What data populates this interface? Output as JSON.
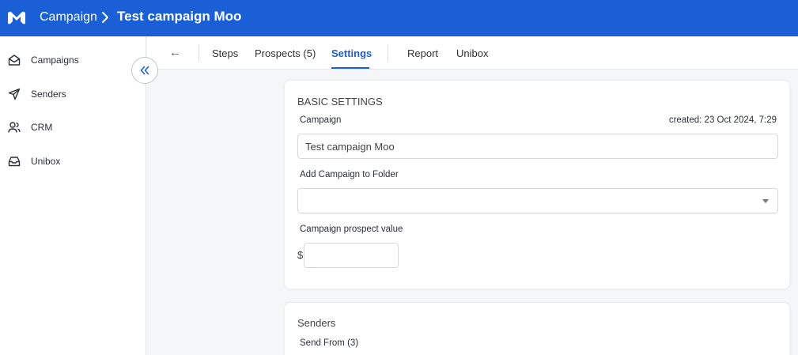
{
  "header": {
    "breadcrumb_root": "Campaign",
    "campaign_title": "Test campaign Moo",
    "brand_color": "#1a5fd6"
  },
  "sidebar": {
    "items": [
      {
        "label": "Campaigns",
        "icon": "envelope-open-icon"
      },
      {
        "label": "Senders",
        "icon": "paper-plane-icon"
      },
      {
        "label": "CRM",
        "icon": "users-icon"
      },
      {
        "label": "Unibox",
        "icon": "inbox-icon"
      }
    ],
    "collapse_icon": "double-chevron-left-icon"
  },
  "tabs": {
    "back": "←",
    "items": [
      {
        "label": "Steps"
      },
      {
        "label": "Prospects (5)"
      },
      {
        "label": "Settings",
        "active": true
      },
      {
        "label": "Report"
      },
      {
        "label": "Unibox"
      }
    ]
  },
  "basic_settings": {
    "title": "BASIC SETTINGS",
    "campaign_label": "Campaign",
    "created": "created: 23 Oct 2024, 7:29",
    "campaign_value": "Test campaign Moo",
    "folder_label": "Add Campaign to Folder",
    "folder_value": "",
    "prospect_value_label": "Campaign prospect value",
    "currency_symbol": "$",
    "prospect_value": ""
  },
  "senders": {
    "title": "Senders",
    "send_from_label": "Send From (3)"
  }
}
